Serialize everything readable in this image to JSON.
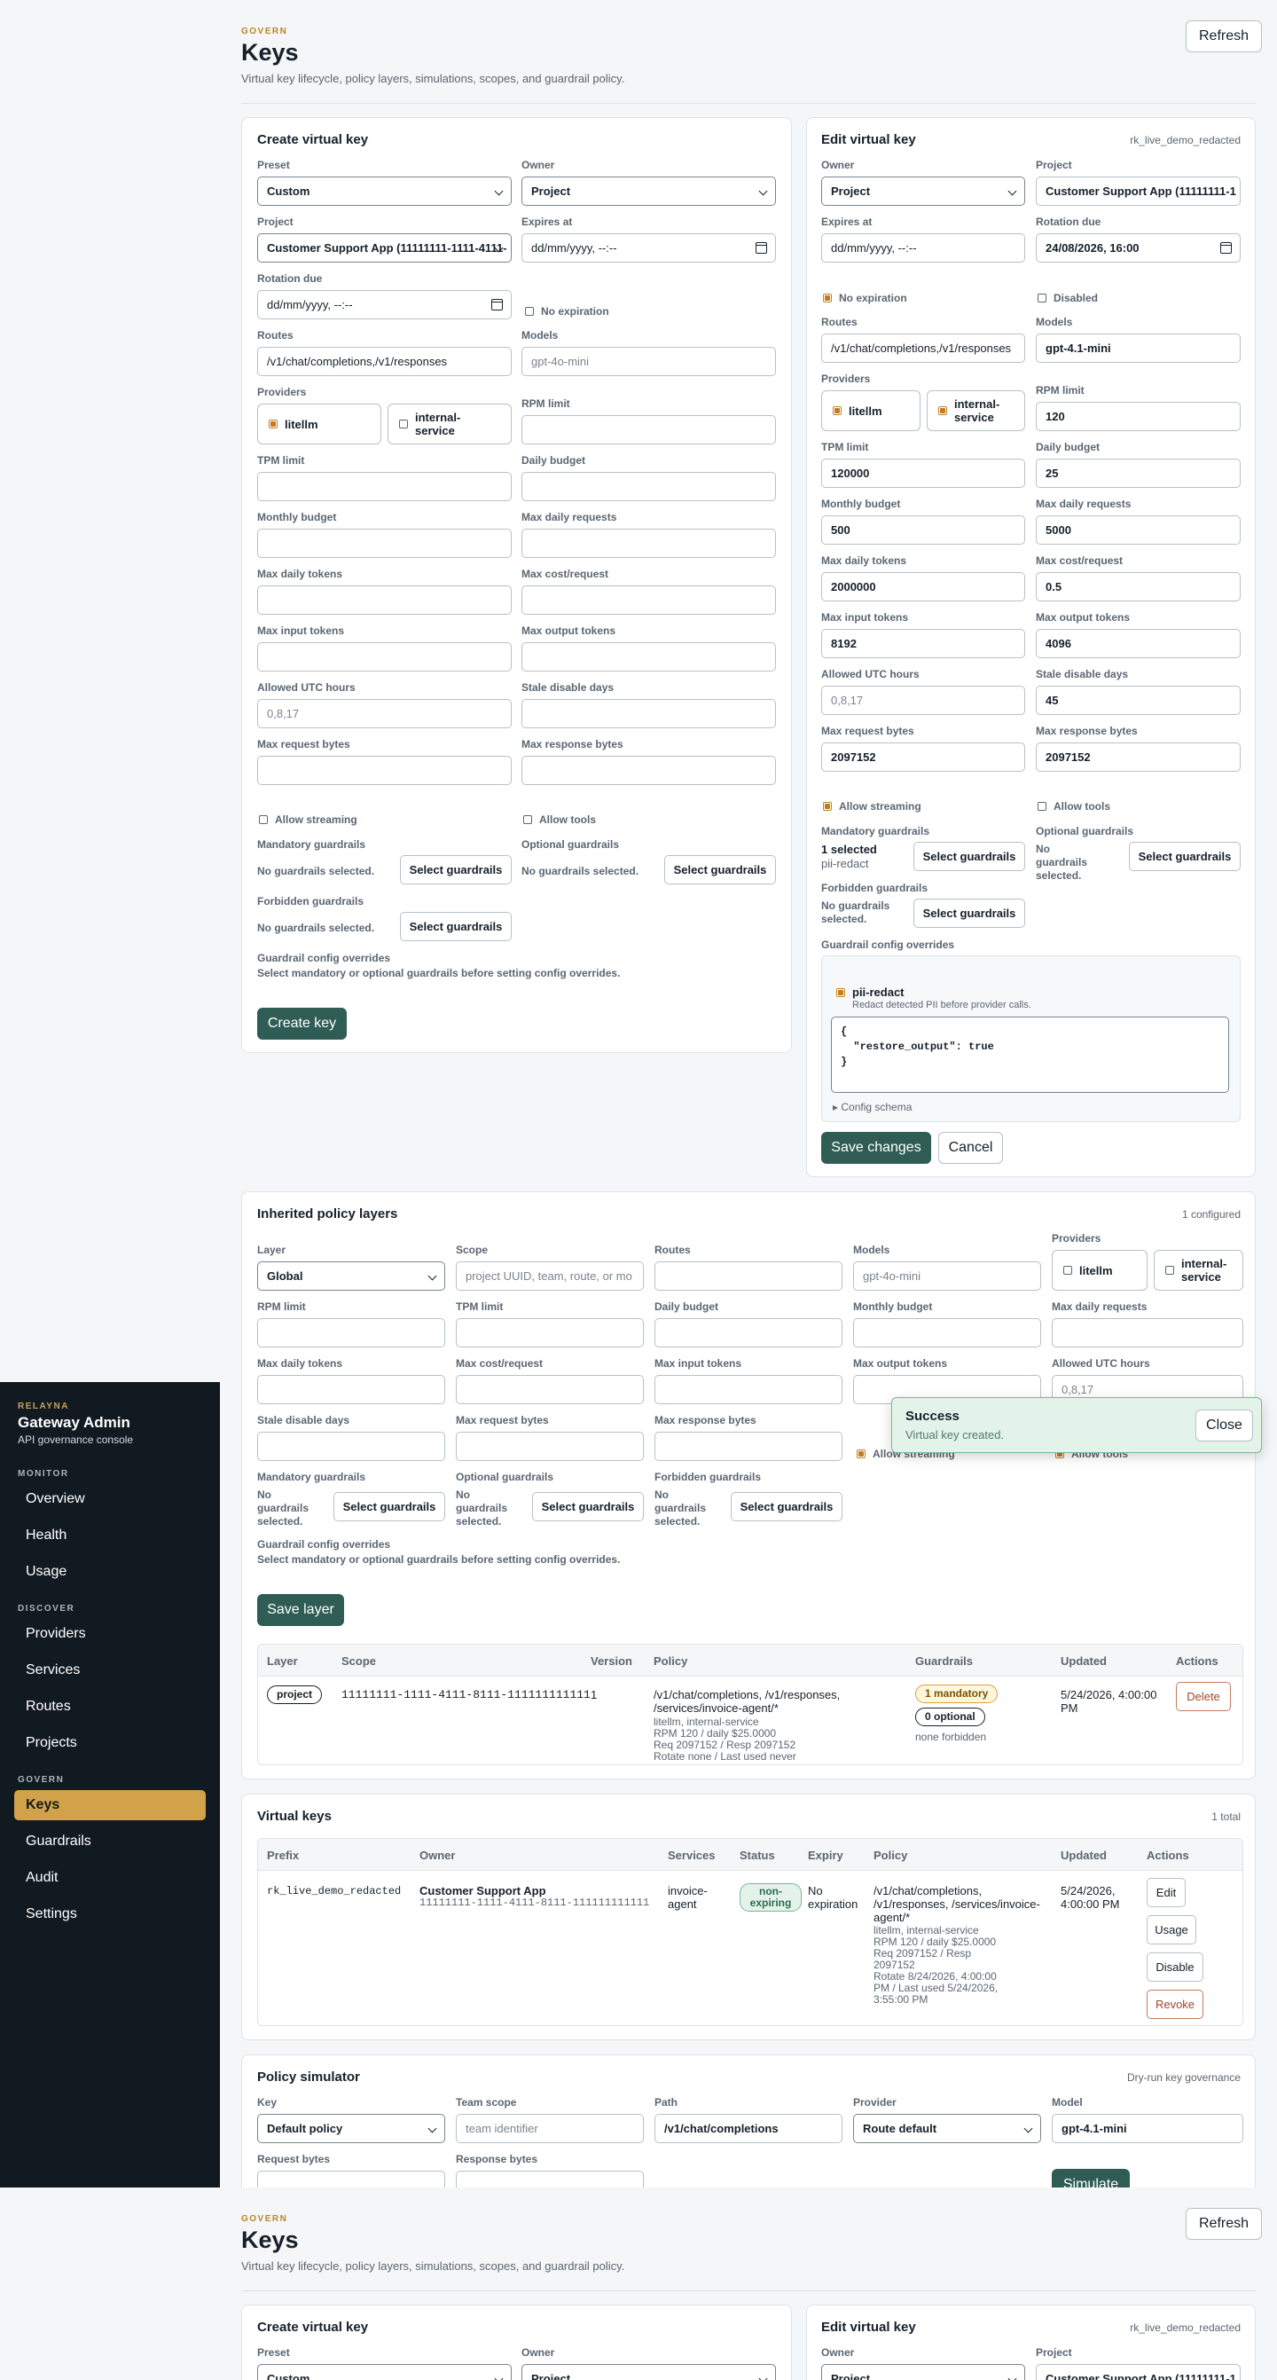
{
  "header": {
    "eyebrow": "GOVERN",
    "title": "Keys",
    "subtitle": "Virtual key lifecycle, policy layers, simulations, scopes, and guardrail policy.",
    "refresh": "Refresh"
  },
  "create": {
    "title": "Create virtual key",
    "preset_label": "Preset",
    "preset_value": "Custom",
    "owner_label": "Owner",
    "owner_value": "Project",
    "project_label": "Project",
    "project_value": "Customer Support App (11111111-1111-4111-",
    "expires_label": "Expires at",
    "expires_value": "dd/mm/yyyy, --:--",
    "rotation_label": "Rotation due",
    "rotation_value": "dd/mm/yyyy, --:--",
    "no_expiration": "No expiration",
    "routes_label": "Routes",
    "routes_value": "/v1/chat/completions,/v1/responses",
    "models_label": "Models",
    "models_placeholder": "gpt-4o-mini",
    "providers_label": "Providers",
    "provider_a": "litellm",
    "provider_b": "internal-service",
    "rpm_label": "RPM limit",
    "tpm_label": "TPM limit",
    "daily_budget_label": "Daily budget",
    "monthly_budget_label": "Monthly budget",
    "max_daily_requests_label": "Max daily requests",
    "max_daily_tokens_label": "Max daily tokens",
    "max_cost_label": "Max cost/request",
    "max_input_label": "Max input tokens",
    "max_output_label": "Max output tokens",
    "utc_label": "Allowed UTC hours",
    "utc_placeholder": "0,8,17",
    "stale_label": "Stale disable days",
    "req_bytes_label": "Max request bytes",
    "resp_bytes_label": "Max response bytes",
    "allow_streaming": "Allow streaming",
    "allow_tools": "Allow tools",
    "mandatory_label": "Mandatory guardrails",
    "optional_label": "Optional guardrails",
    "forbidden_label": "Forbidden guardrails",
    "none_selected": "No guardrails selected.",
    "select_guardrails": "Select guardrails",
    "overrides_label": "Guardrail config overrides",
    "overrides_note": "Select mandatory or optional guardrails before setting config overrides.",
    "create_button": "Create key"
  },
  "edit": {
    "title": "Edit virtual key",
    "key_prefix": "rk_live_demo_redacted",
    "owner_label": "Owner",
    "owner_value": "Project",
    "project_label": "Project",
    "project_value": "Customer Support App (11111111-1",
    "expires_label": "Expires at",
    "expires_value": "dd/mm/yyyy, --:--",
    "rotation_label": "Rotation due",
    "rotation_value": "24/08/2026, 16:00",
    "no_expiration": "No expiration",
    "disabled": "Disabled",
    "routes_label": "Routes",
    "routes_value": "/v1/chat/completions,/v1/responses",
    "models_label": "Models",
    "models_value": "gpt-4.1-mini",
    "providers_label": "Providers",
    "provider_a": "litellm",
    "provider_b": "internal-service",
    "rpm_label": "RPM limit",
    "rpm_value": "120",
    "tpm_label": "TPM limit",
    "tpm_value": "120000",
    "daily_budget_label": "Daily budget",
    "daily_budget_value": "25",
    "monthly_budget_label": "Monthly budget",
    "monthly_budget_value": "500",
    "max_daily_requests_label": "Max daily requests",
    "max_daily_requests_value": "5000",
    "max_daily_tokens_label": "Max daily tokens",
    "max_daily_tokens_value": "2000000",
    "max_cost_label": "Max cost/request",
    "max_cost_value": "0.5",
    "max_input_label": "Max input tokens",
    "max_input_value": "8192",
    "max_output_label": "Max output tokens",
    "max_output_value": "4096",
    "utc_label": "Allowed UTC hours",
    "utc_placeholder": "0,8,17",
    "stale_label": "Stale disable days",
    "stale_value": "45",
    "req_bytes_label": "Max request bytes",
    "req_bytes_value": "2097152",
    "resp_bytes_label": "Max response bytes",
    "resp_bytes_value": "2097152",
    "allow_streaming": "Allow streaming",
    "allow_tools": "Allow tools",
    "mandatory_label": "Mandatory guardrails",
    "mandatory_count": "1 selected",
    "mandatory_item": "pii-redact",
    "optional_label": "Optional guardrails",
    "forbidden_label": "Forbidden guardrails",
    "none_selected": "No guardrails selected.",
    "select_guardrails": "Select guardrails",
    "overrides_label": "Guardrail config overrides",
    "override_name": "pii-redact",
    "override_desc": "Redact detected PII before provider calls.",
    "override_json": "{\n  \"restore_output\": true\n}",
    "config_schema": "▸ Config schema",
    "save_button": "Save changes",
    "cancel_button": "Cancel"
  },
  "layers": {
    "title": "Inherited policy layers",
    "meta": "1 configured",
    "layer_label": "Layer",
    "layer_value": "Global",
    "scope_label": "Scope",
    "scope_placeholder": "project UUID, team, route, or mo",
    "routes_label": "Routes",
    "models_label": "Models",
    "models_placeholder": "gpt-4o-mini",
    "providers_label": "Providers",
    "provider_a": "litellm",
    "provider_b": "internal-service",
    "rpm_label": "RPM limit",
    "tpm_label": "TPM limit",
    "daily_budget_label": "Daily budget",
    "monthly_budget_label": "Monthly budget",
    "max_daily_requests_label": "Max daily requests",
    "max_daily_tokens_label": "Max daily tokens",
    "max_cost_label": "Max cost/request",
    "max_input_label": "Max input tokens",
    "max_output_label": "Max output tokens",
    "utc_label": "Allowed UTC hours",
    "utc_placeholder": "0,8,17",
    "stale_label": "Stale disable days",
    "req_bytes_label": "Max request bytes",
    "resp_bytes_label": "Max response bytes",
    "allow_streaming": "Allow streaming",
    "allow_tools": "Allow tools",
    "mandatory_label": "Mandatory guardrails",
    "optional_label": "Optional guardrails",
    "forbidden_label": "Forbidden guardrails",
    "none_selected": "No guardrails selected.",
    "select_guardrails": "Select guardrails",
    "overrides_label": "Guardrail config overrides",
    "overrides_note": "Select mandatory or optional guardrails before setting config overrides.",
    "save_button": "Save layer",
    "columns": [
      "Layer",
      "Scope",
      "Version",
      "Policy",
      "Guardrails",
      "Updated",
      "Actions"
    ],
    "row": {
      "layer": "project",
      "scope": "11111111-1111-4111-8111-111111111111",
      "version": "1",
      "policy_main": "/v1/chat/completions, /v1/responses, /services/invoice-agent/*",
      "policy_l1": "litellm, internal-service",
      "policy_l2": "RPM 120 / daily $25.0000",
      "policy_l3": "Req 2097152 / Resp 2097152",
      "policy_l4": "Rotate none / Last used never",
      "mandatory": "1 mandatory",
      "optional": "0 optional",
      "forbidden": "none forbidden",
      "updated": "5/24/2026, 4:00:00 PM",
      "delete": "Delete"
    }
  },
  "vkeys": {
    "title": "Virtual keys",
    "meta": "1 total",
    "columns": [
      "Prefix",
      "Owner",
      "Services",
      "Status",
      "Expiry",
      "Policy",
      "Updated",
      "Actions"
    ],
    "row": {
      "prefix": "rk_live_demo_redacted",
      "owner_name": "Customer Support App",
      "owner_id": "11111111-1111-4111-8111-111111111111",
      "services": "invoice-agent",
      "status": "non-expiring",
      "expiry": "No expiration",
      "policy_main": "/v1/chat/completions, /v1/responses, /services/invoice-agent/*",
      "policy_l1": "litellm, internal-service",
      "policy_l2": "RPM 120 / daily $25.0000",
      "policy_l3": "Req 2097152 / Resp 2097152",
      "policy_l4": "Rotate 8/24/2026, 4:00:00 PM / Last used 5/24/2026, 3:55:00 PM",
      "updated": "5/24/2026, 4:00:00 PM",
      "edit": "Edit",
      "usage": "Usage",
      "disable": "Disable",
      "revoke": "Revoke"
    }
  },
  "simulator": {
    "title": "Policy simulator",
    "meta": "Dry-run key governance",
    "key_label": "Key",
    "key_value": "Default policy",
    "team_label": "Team scope",
    "team_placeholder": "team identifier",
    "path_label": "Path",
    "path_value": "/v1/chat/completions",
    "provider_label": "Provider",
    "provider_value": "Route default",
    "model_label": "Model",
    "model_value": "gpt-4.1-mini",
    "req_bytes_label": "Request bytes",
    "resp_bytes_label": "Response bytes",
    "simulate": "Simulate"
  },
  "sidebar": {
    "brand_eyebrow": "RELAYNA",
    "brand_title": "Gateway Admin",
    "brand_sub": "API governance console",
    "monitor": "MONITOR",
    "discover": "DISCOVER",
    "govern": "GOVERN",
    "items": [
      "Overview",
      "Health",
      "Usage",
      "Providers",
      "Services",
      "Routes",
      "Projects",
      "Keys",
      "Guardrails",
      "Audit",
      "Settings"
    ]
  },
  "toast": {
    "title": "Success",
    "message": "Virtual key created.",
    "close": "Close"
  },
  "colors": {
    "accent": "#2f5d55",
    "nav_active": "#d1a24a",
    "sidebar": "#121a21",
    "eyebrow": "#b8862b"
  }
}
